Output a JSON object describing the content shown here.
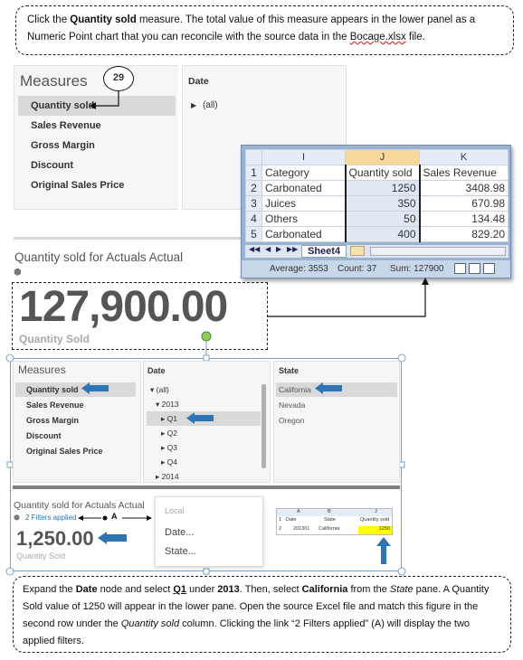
{
  "top_callout": {
    "t1": "Click the ",
    "bold": "Quantity sold",
    "t2": " measure. The total value of this measure appears in the lower panel as a Numeric Point chart that you can reconcile with the source data in the ",
    "link": "Bocage.xlsx",
    "t3": " file."
  },
  "step_badge": "29",
  "measures1": {
    "title": "Measures",
    "items": [
      "Quantity sold",
      "Sales Revenue",
      "Gross Margin",
      "Discount",
      "Original Sales Price"
    ]
  },
  "date1": {
    "title": "Date",
    "item": "(all)"
  },
  "excel": {
    "col_headers": [
      "I",
      "J",
      "K"
    ],
    "rows": [
      {
        "n": "1",
        "a": "Category",
        "b": "Quantity sold",
        "c": "Sales Revenue"
      },
      {
        "n": "2",
        "a": "Carbonated",
        "b": "1250",
        "c": "3408.98"
      },
      {
        "n": "3",
        "a": "Juices",
        "b": "350",
        "c": "670.98"
      },
      {
        "n": "4",
        "a": "Others",
        "b": "50",
        "c": "134.48"
      },
      {
        "n": "5",
        "a": "Carbonated",
        "b": "400",
        "c": "829.20"
      }
    ],
    "sheet_tab": "Sheet4",
    "status": {
      "average": "Average: 3553",
      "count": "Count: 37",
      "sum": "Sum: 127900"
    }
  },
  "chart1": {
    "title": "Quantity sold for Actuals Actual",
    "value": "127,900.00",
    "label": "Quantity Sold"
  },
  "measures2": {
    "title": "Measures",
    "items": [
      "Quantity sold",
      "Sales Revenue",
      "Gross Margin",
      "Discount",
      "Original Sales Price"
    ]
  },
  "date2": {
    "title": "Date",
    "items": [
      "(all)",
      "2013",
      "Q1",
      "Q2",
      "Q3",
      "Q4",
      "2014"
    ]
  },
  "state2": {
    "title": "State",
    "items": [
      "California",
      "Nevada",
      "Oregon"
    ]
  },
  "chart2": {
    "title": "Quantity sold for Actuals Actual",
    "filters_link": "2 Filters applied",
    "marker_a": "A",
    "value": "1,250.00",
    "label": "Quantity Sold"
  },
  "dropdown": {
    "items": [
      "Local",
      "Date...",
      "State..."
    ]
  },
  "mini_sheet": {
    "cols": [
      "A",
      "B",
      "J"
    ],
    "rows": [
      {
        "n": "1",
        "a": "Date",
        "b": "State",
        "c": "Quantity sold"
      },
      {
        "n": "2",
        "a": "201301",
        "b": "California",
        "c": "1250"
      }
    ]
  },
  "bottom_callout": {
    "t1": "Expand the ",
    "b1": "Date",
    "t2": " node and select ",
    "b2": "Q1",
    "t3": " under ",
    "b3": "2013",
    "t4": ". Then, select ",
    "b4": "California",
    "t5": " from the ",
    "i1": "State",
    "t6": " pane. A Quantity Sold value of 1250 will appear in the lower pane. Open the source Excel file and match this figure in the second row under the ",
    "i2": "Quantity sold",
    "t7": " column. Clicking the link “2 Filters applied” (A) will display the two applied filters."
  }
}
